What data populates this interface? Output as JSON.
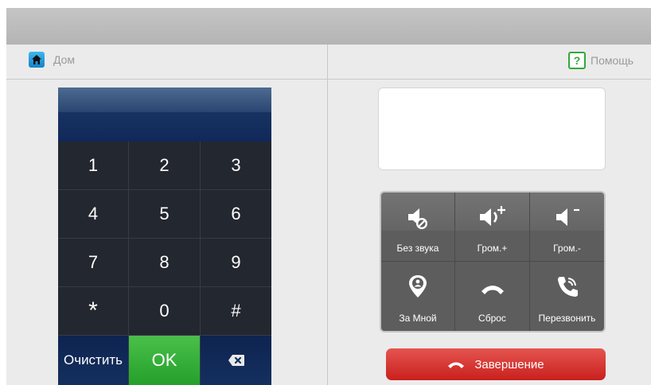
{
  "header": {
    "home_label": "Дом",
    "help_label": "Помощь",
    "help_icon_text": "?"
  },
  "keypad": {
    "display_value": "",
    "keys": [
      "1",
      "2",
      "3",
      "4",
      "5",
      "6",
      "7",
      "8",
      "9",
      "*",
      "0",
      "#"
    ],
    "clear_label": "Очистить",
    "ok_label": "OK"
  },
  "call_panel": {
    "info_text": "",
    "buttons": [
      {
        "label": "Без звука",
        "icon": "mute-icon"
      },
      {
        "label": "Гром.+",
        "icon": "volume-up-icon"
      },
      {
        "label": "Гром.-",
        "icon": "volume-down-icon"
      },
      {
        "label": "За Мной",
        "icon": "location-person-icon"
      },
      {
        "label": "Сброс",
        "icon": "hangup-icon"
      },
      {
        "label": "Перезвонить",
        "icon": "callback-icon"
      }
    ],
    "end_label": "Завершение"
  },
  "colors": {
    "ok_green": "#25a02b",
    "end_red": "#d6302c",
    "keypad_dark": "#222631",
    "home_blue": "#1582c8",
    "help_green": "#34a83a"
  }
}
